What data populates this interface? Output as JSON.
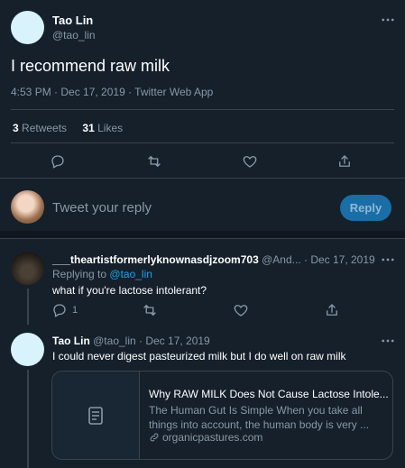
{
  "main_tweet": {
    "name": "Tao Lin",
    "handle": "@tao_lin",
    "text": "I recommend raw milk",
    "timestamp": "4:53 PM · Dec 17, 2019 · Twitter Web App",
    "retweets_count": "3",
    "retweets_label": "Retweets",
    "likes_count": "31",
    "likes_label": "Likes"
  },
  "composer": {
    "placeholder": "Tweet your reply",
    "reply_label": "Reply"
  },
  "replies": [
    {
      "name": "___theartistformerlyknownasdjzoom703",
      "handle": "@And...",
      "date": "· Dec 17, 2019",
      "replying_prefix": "Replying to",
      "replying_to": "@tao_lin",
      "text": "what if you're lactose intolerant?",
      "reply_count": "1"
    },
    {
      "name": "Tao Lin",
      "handle": "@tao_lin",
      "date": "· Dec 17, 2019",
      "text": "I could never digest pasteurized milk but I do well on raw milk",
      "card": {
        "title": "Why RAW MILK Does Not Cause Lactose Intole...",
        "description": "The Human Gut Is Simple When you take all things into account, the human body is very ...",
        "domain": "organicpastures.com"
      }
    }
  ],
  "colors": {
    "background": "#15202b",
    "accent": "#1da1f2",
    "muted": "#8899a6",
    "border": "#38444d"
  }
}
